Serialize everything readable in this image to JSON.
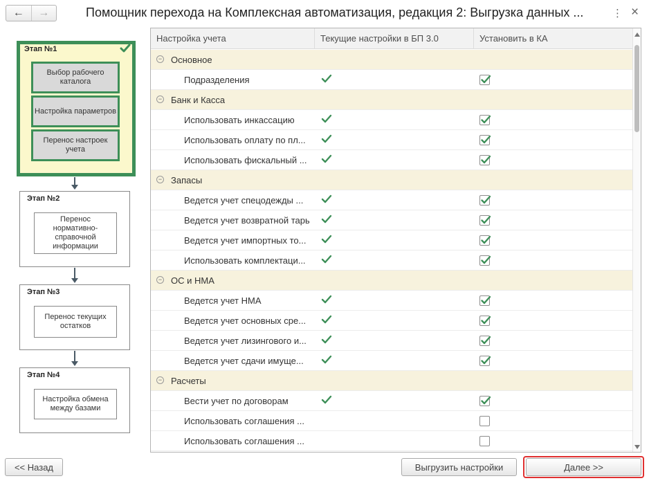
{
  "window": {
    "title": "Помощник перехода на Комплексная автоматизация, редакция 2: Выгрузка данных ...",
    "back_icon": "arrow-left-icon",
    "forward_icon": "arrow-right-icon",
    "more_icon": "⋮",
    "close_icon": "×"
  },
  "stages": [
    {
      "label": "Этап №1",
      "active": true,
      "completed": true,
      "steps": [
        "Выбор рабочего каталога",
        "Настройка параметров",
        "Перенос настроек учета"
      ]
    },
    {
      "label": "Этап №2",
      "active": false,
      "steps": [
        "Перенос нормативно-справочной информации"
      ]
    },
    {
      "label": "Этап №3",
      "active": false,
      "steps": [
        "Перенос текущих остатков"
      ]
    },
    {
      "label": "Этап №4",
      "active": false,
      "steps": [
        "Настройка обмена между базами"
      ]
    }
  ],
  "table": {
    "columns": [
      "Настройка учета",
      "Текущие настройки в БП 3.0",
      "Установить в КА"
    ],
    "rows": [
      {
        "type": "group",
        "label": "Основное"
      },
      {
        "type": "item",
        "label": "Подразделения",
        "current": true,
        "set": true
      },
      {
        "type": "group",
        "label": "Банк и Касса"
      },
      {
        "type": "item",
        "label": "Использовать инкассацию",
        "current": true,
        "set": true
      },
      {
        "type": "item",
        "label": "Использовать оплату по пл...",
        "current": true,
        "set": true
      },
      {
        "type": "item",
        "label": "Использовать фискальный ...",
        "current": true,
        "set": true
      },
      {
        "type": "group",
        "label": "Запасы"
      },
      {
        "type": "item",
        "label": "Ведется учет спецодежды ...",
        "current": true,
        "set": true
      },
      {
        "type": "item",
        "label": "Ведется учет возвратной тары",
        "current": true,
        "set": true
      },
      {
        "type": "item",
        "label": "Ведется учет импортных то...",
        "current": true,
        "set": true
      },
      {
        "type": "item",
        "label": "Использовать комплектаци...",
        "current": true,
        "set": true
      },
      {
        "type": "group",
        "label": "ОС и НМА"
      },
      {
        "type": "item",
        "label": "Ведется учет НМА",
        "current": true,
        "set": true
      },
      {
        "type": "item",
        "label": "Ведется учет основных сре...",
        "current": true,
        "set": true
      },
      {
        "type": "item",
        "label": "Ведется учет лизингового и...",
        "current": true,
        "set": true
      },
      {
        "type": "item",
        "label": "Ведется учет сдачи имуще...",
        "current": true,
        "set": true
      },
      {
        "type": "group",
        "label": "Расчеты"
      },
      {
        "type": "item",
        "label": "Вести учет по договорам",
        "current": true,
        "set": true
      },
      {
        "type": "item",
        "label": "Использовать соглашения ...",
        "current": false,
        "set": false
      },
      {
        "type": "item",
        "label": "Использовать соглашения ...",
        "current": false,
        "set": false
      }
    ]
  },
  "buttons": {
    "back": "<< Назад",
    "export": "Выгрузить настройки",
    "next": "Далее >>"
  },
  "colors": {
    "accent_green": "#3d8f58",
    "active_stage_bg": "#fbf8cc",
    "group_row_bg": "#f7f2dd",
    "highlight_red": "#e03030"
  }
}
